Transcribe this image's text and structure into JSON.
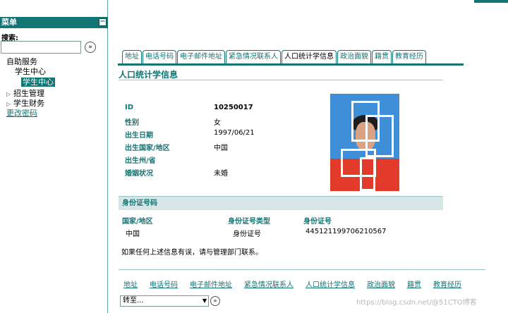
{
  "sidebar": {
    "header": "菜单",
    "collapse_icon": "minus-icon",
    "search_label": "搜索:",
    "search_value": "",
    "search_go_icon": "arrow-right-circle-icon",
    "tree": [
      {
        "label": "自助服务"
      },
      {
        "label": "学生中心"
      },
      {
        "label": "学生中心"
      },
      {
        "label": "招生管理"
      },
      {
        "label": "学生财务"
      }
    ],
    "change_password": "更改密码"
  },
  "tabs": [
    "地址",
    "电话号码",
    "电子邮件地址",
    "紧急情况联系人",
    "人口统计学信息",
    "政治面貌",
    "籍贯",
    "教育经历"
  ],
  "page_title": "人口统计学信息",
  "info": [
    {
      "label": "ID",
      "value": "10250017"
    },
    {
      "label": "性别",
      "value": "女"
    },
    {
      "label": "出生日期",
      "value": "1997/06/21"
    },
    {
      "label": "出生国家/地区",
      "value": "中国"
    },
    {
      "label": "出生州/省",
      "value": ""
    },
    {
      "label": "婚姻状况",
      "value": "未婚"
    }
  ],
  "id_section": {
    "title": "身份证号码",
    "headers": [
      "国家/地区",
      "身份证号类型",
      "身份证号"
    ],
    "row": [
      "中国",
      "身份证号",
      "445121199706210567"
    ]
  },
  "notice": "如果任何上述信息有误，请与管理部门联系。",
  "bottom_links": [
    "地址",
    "电话号码",
    "电子邮件地址",
    "紧急情况联系人",
    "人口统计学信息",
    "政治面貌",
    "籍贯",
    "教育经历"
  ],
  "goto": {
    "value": "转至...",
    "go_icon": "arrow-right-circle-icon"
  },
  "watermark": "https://blog.csdn.net/@51CTO博客",
  "colors": {
    "accent": "#137474",
    "header_band": "#d6e6e6"
  }
}
